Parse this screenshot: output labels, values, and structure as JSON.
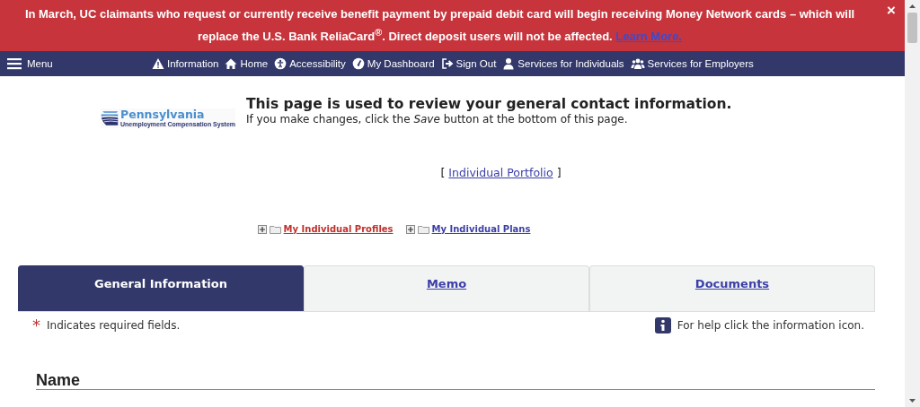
{
  "alert": {
    "message": "In March, UC claimants who request or currently receive benefit payment by prepaid debit card will begin receiving Money Network cards – which will replace the U.S. Bank ReliaCard$^{®}$. Direct deposit users will not be affected.",
    "link": "Learn More.",
    "close": "×"
  },
  "navbar": {
    "menu": "Menu",
    "items": [
      {
        "label": "Information"
      },
      {
        "label": "Home"
      },
      {
        "label": "Accessibility"
      },
      {
        "label": "My Dashboard"
      },
      {
        "label": "Sign Out"
      },
      {
        "label": "Services for Individuals"
      },
      {
        "label": "Services for Employers"
      }
    ]
  },
  "logo": {
    "name": "Pennsylvania",
    "subtitle": "Unemployment Compensation System"
  },
  "header": {
    "title": "This page is used to review your general contact information.",
    "subtitle": "If you make changes, click the *Save* button at the bottom of this page."
  },
  "portfolio": {
    "open": "[",
    "link": "Individual Portfolio",
    "close": "]"
  },
  "tree": [
    {
      "label": "My Individual Profiles",
      "color": "#c0302c",
      "expanded": false
    },
    {
      "label": "My Individual Plans",
      "color": "#3b3fa8",
      "expanded": false
    }
  ],
  "tabs": [
    {
      "label": "General Information",
      "selected": true
    },
    {
      "label": "Memo",
      "selected": false
    },
    {
      "label": "Documents",
      "selected": false
    }
  ],
  "required_note": {
    "mark": "*",
    "text": "Indicates required fields."
  },
  "help_note": "For help click the information icon.",
  "section_title": "Name"
}
